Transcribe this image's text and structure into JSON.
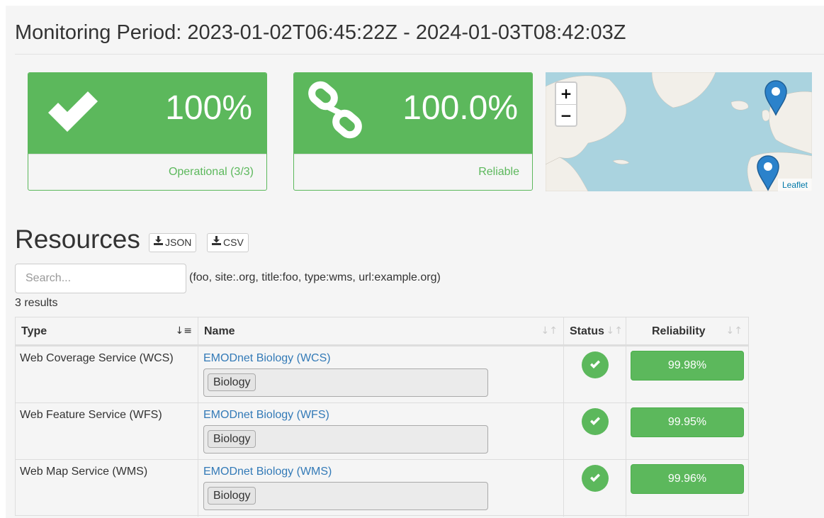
{
  "header": {
    "title": "Monitoring Period: 2023-01-02T06:45:22Z - 2024-01-03T08:42:03Z"
  },
  "stats": {
    "operational": {
      "value": "100%",
      "label": "Operational (3/3)",
      "icon": "check-icon"
    },
    "reliability": {
      "value": "100.0%",
      "label": "Reliable",
      "icon": "chain-link-icon"
    }
  },
  "map": {
    "zoom_in": "+",
    "zoom_out": "−",
    "attribution": "Leaflet"
  },
  "resources": {
    "title": "Resources",
    "download_json": "JSON",
    "download_csv": "CSV",
    "search_placeholder": "Search...",
    "search_hint": "(foo, site:.org, title:foo, type:wms, url:example.org)",
    "results_count": "3 results"
  },
  "table": {
    "columns": {
      "type": "Type",
      "name": "Name",
      "status": "Status",
      "reliability": "Reliability"
    },
    "rows": [
      {
        "type": "Web Coverage Service (WCS)",
        "name": "EMODnet Biology (WCS)",
        "tag": "Biology",
        "reliability": "99.98%"
      },
      {
        "type": "Web Feature Service (WFS)",
        "name": "EMODnet Biology (WFS)",
        "tag": "Biology",
        "reliability": "99.95%"
      },
      {
        "type": "Web Map Service (WMS)",
        "name": "EMODnet Biology (WMS)",
        "tag": "Biology",
        "reliability": "99.96%"
      }
    ]
  },
  "colors": {
    "success": "#5cb85c",
    "link": "#337ab7",
    "map_water": "#aad3df",
    "map_land": "#f2efe9"
  }
}
